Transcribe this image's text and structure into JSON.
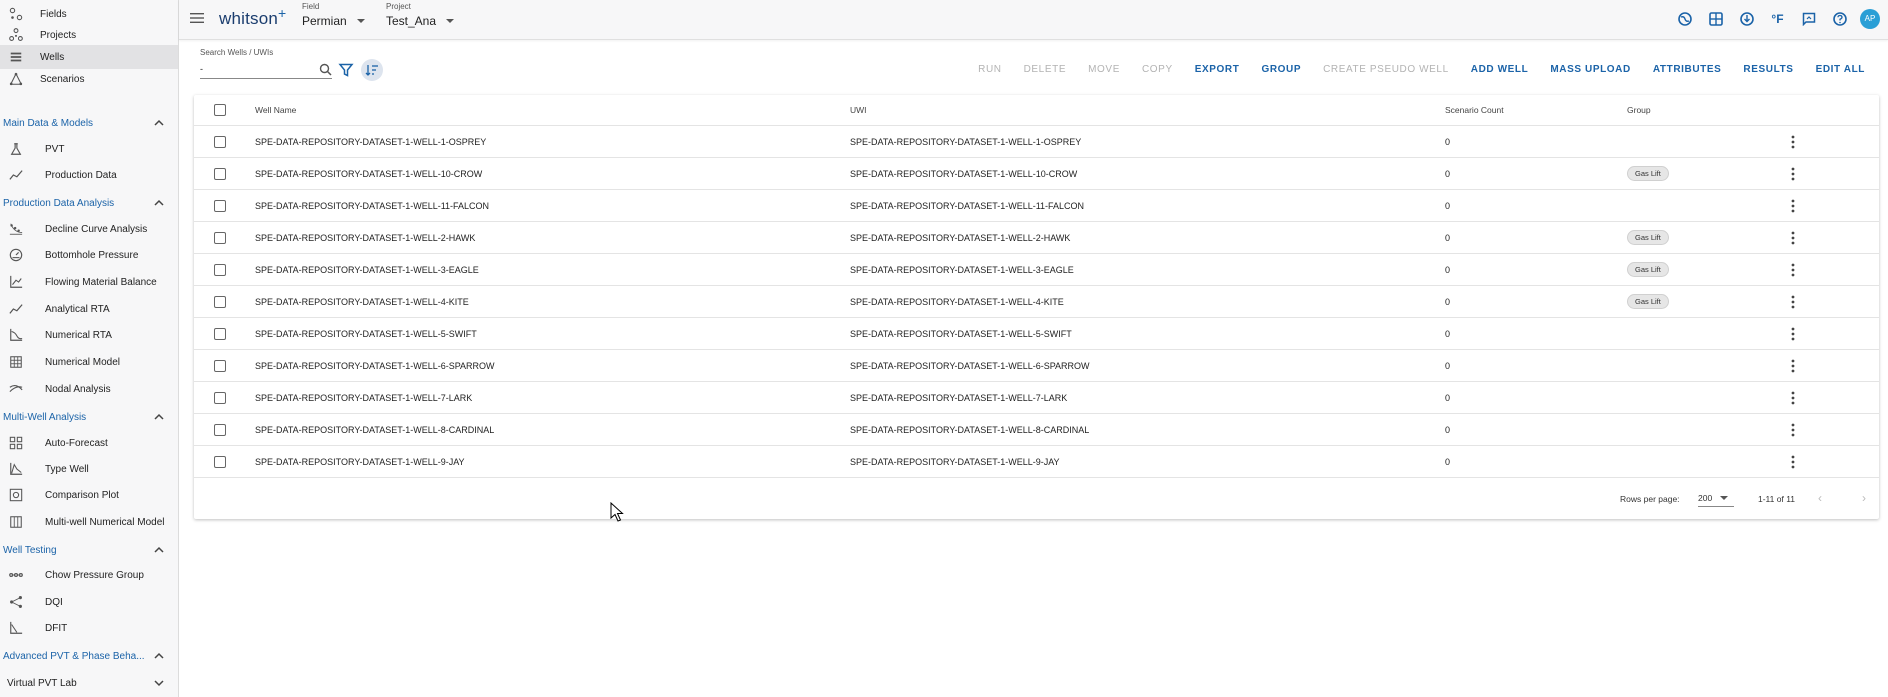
{
  "app": {
    "logo_text": "whitson",
    "logo_plus": "+",
    "field_caption": "Field",
    "field_value": "Permian",
    "project_caption": "Project",
    "project_value": "Test_Ana",
    "unit_label": "°F",
    "avatar_initials": "AP",
    "accent_color": "#1b63a8"
  },
  "sidebar": {
    "top_items": [
      {
        "label": "Fields",
        "icon": "fields-icon"
      },
      {
        "label": "Projects",
        "icon": "projects-icon"
      },
      {
        "label": "Wells",
        "icon": "wells-icon",
        "active": true
      },
      {
        "label": "Scenarios",
        "icon": "scenarios-icon"
      }
    ],
    "sections": [
      {
        "title": "Main Data & Models",
        "items": [
          {
            "label": "PVT",
            "icon": "flask-icon"
          },
          {
            "label": "Production Data",
            "icon": "trend-icon"
          }
        ]
      },
      {
        "title": "Production Data Analysis",
        "items": [
          {
            "label": "Decline Curve Analysis",
            "icon": "decline-icon"
          },
          {
            "label": "Bottomhole Pressure",
            "icon": "gauge-icon"
          },
          {
            "label": "Flowing Material Balance",
            "icon": "chart-icon"
          },
          {
            "label": "Analytical RTA",
            "icon": "trend-icon"
          },
          {
            "label": "Numerical RTA",
            "icon": "numerical-icon"
          },
          {
            "label": "Numerical Model",
            "icon": "grid-icon"
          },
          {
            "label": "Nodal Analysis",
            "icon": "nodal-icon"
          }
        ]
      },
      {
        "title": "Multi-Well Analysis",
        "items": [
          {
            "label": "Auto-Forecast",
            "icon": "dashboard-icon"
          },
          {
            "label": "Type Well",
            "icon": "typewell-icon"
          },
          {
            "label": "Comparison Plot",
            "icon": "comparison-icon"
          },
          {
            "label": "Multi-well Numerical Model",
            "icon": "columns-icon"
          }
        ]
      },
      {
        "title": "Well Testing",
        "items": [
          {
            "label": "Chow Pressure Group",
            "icon": "dots-line-icon"
          },
          {
            "label": "DQI",
            "icon": "share-icon"
          },
          {
            "label": "DFIT",
            "icon": "dfit-icon"
          }
        ]
      }
    ],
    "bottom_sections": [
      {
        "title": "Advanced PVT & Phase Beha..."
      },
      {
        "title": "Virtual PVT Lab"
      }
    ]
  },
  "toolbar": {
    "search_caption": "Search Wells / UWIs",
    "search_value": "-",
    "actions": [
      {
        "label": "RUN",
        "enabled": false
      },
      {
        "label": "DELETE",
        "enabled": false
      },
      {
        "label": "MOVE",
        "enabled": false
      },
      {
        "label": "COPY",
        "enabled": false
      },
      {
        "label": "EXPORT",
        "enabled": true
      },
      {
        "label": "GROUP",
        "enabled": true
      },
      {
        "label": "CREATE PSEUDO WELL",
        "enabled": false
      },
      {
        "label": "ADD WELL",
        "enabled": true
      },
      {
        "label": "MASS UPLOAD",
        "enabled": true
      },
      {
        "label": "ATTRIBUTES",
        "enabled": true
      },
      {
        "label": "RESULTS",
        "enabled": true
      },
      {
        "label": "EDIT ALL",
        "enabled": true
      }
    ]
  },
  "table": {
    "columns": [
      "Well Name",
      "UWI",
      "Scenario Count",
      "Group"
    ],
    "rows": [
      {
        "name": "SPE-DATA-REPOSITORY-DATASET-1-WELL-1-OSPREY",
        "uwi": "SPE-DATA-REPOSITORY-DATASET-1-WELL-1-OSPREY",
        "count": "0",
        "group": ""
      },
      {
        "name": "SPE-DATA-REPOSITORY-DATASET-1-WELL-10-CROW",
        "uwi": "SPE-DATA-REPOSITORY-DATASET-1-WELL-10-CROW",
        "count": "0",
        "group": "Gas Lift"
      },
      {
        "name": "SPE-DATA-REPOSITORY-DATASET-1-WELL-11-FALCON",
        "uwi": "SPE-DATA-REPOSITORY-DATASET-1-WELL-11-FALCON",
        "count": "0",
        "group": ""
      },
      {
        "name": "SPE-DATA-REPOSITORY-DATASET-1-WELL-2-HAWK",
        "uwi": "SPE-DATA-REPOSITORY-DATASET-1-WELL-2-HAWK",
        "count": "0",
        "group": "Gas Lift"
      },
      {
        "name": "SPE-DATA-REPOSITORY-DATASET-1-WELL-3-EAGLE",
        "uwi": "SPE-DATA-REPOSITORY-DATASET-1-WELL-3-EAGLE",
        "count": "0",
        "group": "Gas Lift"
      },
      {
        "name": "SPE-DATA-REPOSITORY-DATASET-1-WELL-4-KITE",
        "uwi": "SPE-DATA-REPOSITORY-DATASET-1-WELL-4-KITE",
        "count": "0",
        "group": "Gas Lift"
      },
      {
        "name": "SPE-DATA-REPOSITORY-DATASET-1-WELL-5-SWIFT",
        "uwi": "SPE-DATA-REPOSITORY-DATASET-1-WELL-5-SWIFT",
        "count": "0",
        "group": ""
      },
      {
        "name": "SPE-DATA-REPOSITORY-DATASET-1-WELL-6-SPARROW",
        "uwi": "SPE-DATA-REPOSITORY-DATASET-1-WELL-6-SPARROW",
        "count": "0",
        "group": ""
      },
      {
        "name": "SPE-DATA-REPOSITORY-DATASET-1-WELL-7-LARK",
        "uwi": "SPE-DATA-REPOSITORY-DATASET-1-WELL-7-LARK",
        "count": "0",
        "group": ""
      },
      {
        "name": "SPE-DATA-REPOSITORY-DATASET-1-WELL-8-CARDINAL",
        "uwi": "SPE-DATA-REPOSITORY-DATASET-1-WELL-8-CARDINAL",
        "count": "0",
        "group": ""
      },
      {
        "name": "SPE-DATA-REPOSITORY-DATASET-1-WELL-9-JAY",
        "uwi": "SPE-DATA-REPOSITORY-DATASET-1-WELL-9-JAY",
        "count": "0",
        "group": ""
      }
    ],
    "pagination": {
      "rows_per_page_label": "Rows per page:",
      "rows_per_page_value": "200",
      "range_text": "1-11 of 11"
    }
  }
}
